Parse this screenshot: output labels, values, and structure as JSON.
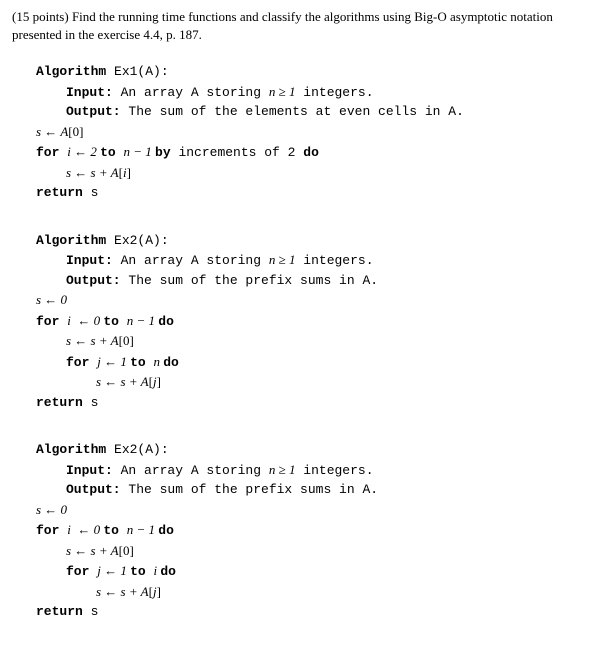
{
  "question": {
    "points": "(15 points)",
    "text1": " Find the running time functions and classify the algorithms using Big-O asymptotic notation",
    "text2": "presented in the exercise 4.4, p. 187."
  },
  "algo1": {
    "header_kw": "Algorithm",
    "header_name": " Ex1(A):",
    "input_kw": "Input:",
    "input_text": " An array A storing ",
    "input_math": "n ≥ 1",
    "input_text2": " integers.",
    "output_kw": "Output:",
    "output_text": " The sum of the elements at even cells in A.",
    "line1_a": "s ← A",
    "line1_b": "[0]",
    "line2_for": "for ",
    "line2_var": "i",
    "line2_arrow": " ← 2 ",
    "line2_to": "to ",
    "line2_end": "n − 1 ",
    "line2_by": "by",
    "line2_inc": " increments of 2 ",
    "line2_do": "do",
    "line3_a": "s ← s + A",
    "line3_b": "[",
    "line3_c": "i",
    "line3_d": "]",
    "line4_ret": "return",
    "line4_s": " s"
  },
  "algo2": {
    "header_kw": "Algorithm",
    "header_name": " Ex2(A):",
    "input_kw": "Input:",
    "input_text": " An array A storing ",
    "input_math": "n ≥ 1",
    "input_text2": " integers.",
    "output_kw": "Output:",
    "output_text": " The sum of the prefix sums in A.",
    "line1": "s ← 0",
    "line2_for": "for ",
    "line2_rest": "i  ← 0 ",
    "line2_to": "to ",
    "line2_end": "n − 1 ",
    "line2_do": "do",
    "line3_a": "s ← s + A",
    "line3_b": "[0]",
    "line4_for": "for ",
    "line4_var": "j",
    "line4_arrow": " ← 1 ",
    "line4_to": "to ",
    "line4_end": "n ",
    "line4_do": "do",
    "line5_a": "s ← s + A",
    "line5_b": "[",
    "line5_c": "j",
    "line5_d": "]",
    "line6_ret": "return",
    "line6_s": " s"
  },
  "algo3": {
    "header_kw": "Algorithm",
    "header_name": " Ex2(A):",
    "input_kw": "Input:",
    "input_text": " An array A storing ",
    "input_math": "n ≥ 1",
    "input_text2": " integers.",
    "output_kw": "Output:",
    "output_text": " The sum of the prefix sums in A.",
    "line1": "s ← 0",
    "line2_for": "for ",
    "line2_rest": "i  ← 0 ",
    "line2_to": "to ",
    "line2_end": "n − 1 ",
    "line2_do": "do",
    "line3_a": "s ← s + A",
    "line3_b": "[0]",
    "line4_for": "for ",
    "line4_var": "j",
    "line4_arrow": " ← 1 ",
    "line4_to": "to ",
    "line4_end": "i ",
    "line4_do": "do",
    "line5_a": "s ← s + A",
    "line5_b": "[",
    "line5_c": "j",
    "line5_d": "]",
    "line6_ret": "return",
    "line6_s": " s"
  }
}
